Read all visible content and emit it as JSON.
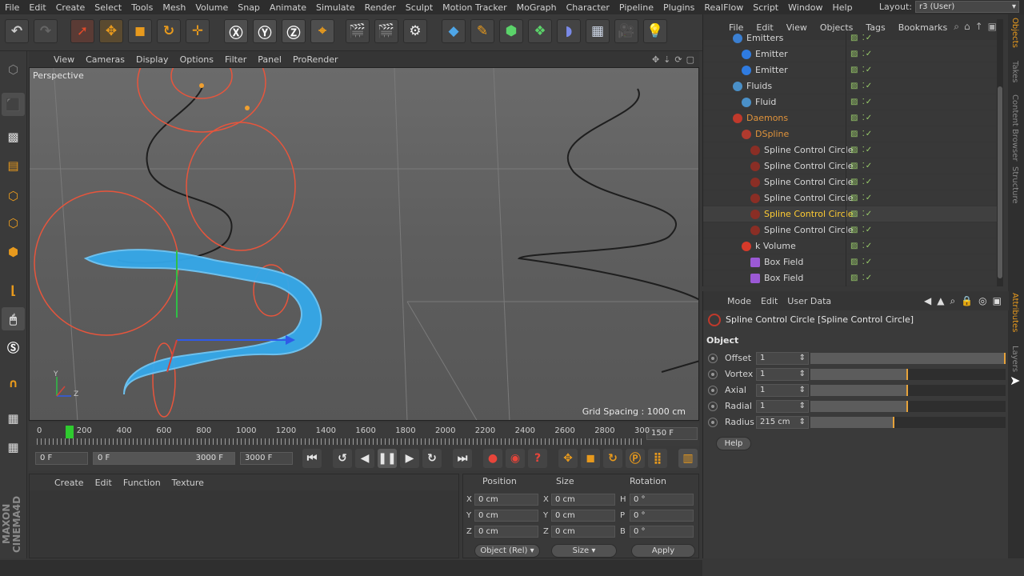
{
  "menubar": {
    "items": [
      "File",
      "Edit",
      "Create",
      "Select",
      "Tools",
      "Mesh",
      "Volume",
      "Snap",
      "Animate",
      "Simulate",
      "Render",
      "Sculpt",
      "Motion Tracker",
      "MoGraph",
      "Character",
      "Pipeline",
      "Plugins",
      "RealFlow",
      "Script",
      "Window",
      "Help"
    ],
    "layout_label": "Layout:",
    "layout_value": "r3 (User)"
  },
  "viewport": {
    "menu": [
      "View",
      "Cameras",
      "Display",
      "Options",
      "Filter",
      "Panel",
      "ProRender"
    ],
    "label": "Perspective",
    "grid_spacing": "Grid Spacing : 1000 cm",
    "axes": {
      "y": "Y",
      "z": "Z"
    }
  },
  "timeline": {
    "ticks": [
      "0",
      "200",
      "400",
      "600",
      "800",
      "1000",
      "1200",
      "1400",
      "1600",
      "1800",
      "2000",
      "2200",
      "2400",
      "2600",
      "2800",
      "300"
    ],
    "end_frame": "150 F"
  },
  "transport": {
    "current_frame": "0 F",
    "range_start": "0 F",
    "range_end": "3000 F",
    "max_frame": "3000 F"
  },
  "material_panel": {
    "menu": [
      "Create",
      "Edit",
      "Function",
      "Texture"
    ]
  },
  "coords": {
    "headers": {
      "position": "Position",
      "size": "Size",
      "rotation": "Rotation"
    },
    "rows": [
      {
        "pl": "X",
        "pv": "0 cm",
        "sl": "X",
        "sv": "0 cm",
        "rl": "H",
        "rv": "0 °"
      },
      {
        "pl": "Y",
        "pv": "0 cm",
        "sl": "Y",
        "sv": "0 cm",
        "rl": "P",
        "rv": "0 °"
      },
      {
        "pl": "Z",
        "pv": "0 cm",
        "sl": "Z",
        "sv": "0 cm",
        "rl": "B",
        "rv": "0 °"
      }
    ],
    "mode_select": "Object (Rel)",
    "size_select": "Size",
    "apply_label": "Apply"
  },
  "object_manager": {
    "menu": [
      "File",
      "Edit",
      "View",
      "Objects",
      "Tags",
      "Bookmarks"
    ],
    "rows": [
      {
        "name": "Emitters",
        "indent": 1,
        "style": "normal",
        "icon": "#3b7fd1"
      },
      {
        "name": "Emitter",
        "indent": 2,
        "style": "normal",
        "icon": "#2f7be0"
      },
      {
        "name": "Emitter",
        "indent": 2,
        "style": "normal",
        "icon": "#2f7be0"
      },
      {
        "name": "Fluids",
        "indent": 1,
        "style": "normal",
        "icon": "#4a90c8"
      },
      {
        "name": "Fluid",
        "indent": 2,
        "style": "normal",
        "icon": "#4a90c8"
      },
      {
        "name": "Daemons",
        "indent": 1,
        "style": "orange",
        "icon": "#c0392b"
      },
      {
        "name": "DSpline",
        "indent": 2,
        "style": "orange",
        "icon": "#b03a2e"
      },
      {
        "name": "Spline Control Circle",
        "indent": 3,
        "style": "normal",
        "icon": "#8a2e25"
      },
      {
        "name": "Spline Control Circle",
        "indent": 3,
        "style": "normal",
        "icon": "#8a2e25"
      },
      {
        "name": "Spline Control Circle",
        "indent": 3,
        "style": "normal",
        "icon": "#8a2e25"
      },
      {
        "name": "Spline Control Circle",
        "indent": 3,
        "style": "normal",
        "icon": "#8a2e25"
      },
      {
        "name": "Spline Control Circle",
        "indent": 3,
        "style": "yellow",
        "icon": "#8a2e25"
      },
      {
        "name": "Spline Control Circle",
        "indent": 3,
        "style": "normal",
        "icon": "#8a2e25"
      },
      {
        "name": "k Volume",
        "indent": 2,
        "style": "normal",
        "icon": "#d63a2a"
      },
      {
        "name": "Box Field",
        "indent": 3,
        "style": "normal",
        "icon": "#9b59d6"
      },
      {
        "name": "Box Field",
        "indent": 3,
        "style": "normal",
        "icon": "#9b59d6"
      }
    ]
  },
  "side_tabs": [
    "Objects",
    "Takes",
    "Content Browser",
    "Structure",
    "Attributes",
    "Layers"
  ],
  "attributes": {
    "menu": [
      "Mode",
      "Edit",
      "User Data"
    ],
    "title": "Spline Control Circle [Spline Control Circle]",
    "section": "Object",
    "params": [
      {
        "label": "Offset",
        "value": "1",
        "fill": 1.0
      },
      {
        "label": "Vortex",
        "value": "1",
        "fill": 0.5
      },
      {
        "label": "Axial",
        "value": "1",
        "fill": 0.5
      },
      {
        "label": "Radial",
        "value": "1",
        "fill": 0.5
      },
      {
        "label": "Radius",
        "value": "215 cm",
        "fill": 0.43
      }
    ],
    "help_label": "Help"
  },
  "colors": {
    "accent_orange": "#e89a1d",
    "selection_yellow": "#ffcc33",
    "fluid_blue": "#35a8ea",
    "spline_red": "#e8553c"
  }
}
